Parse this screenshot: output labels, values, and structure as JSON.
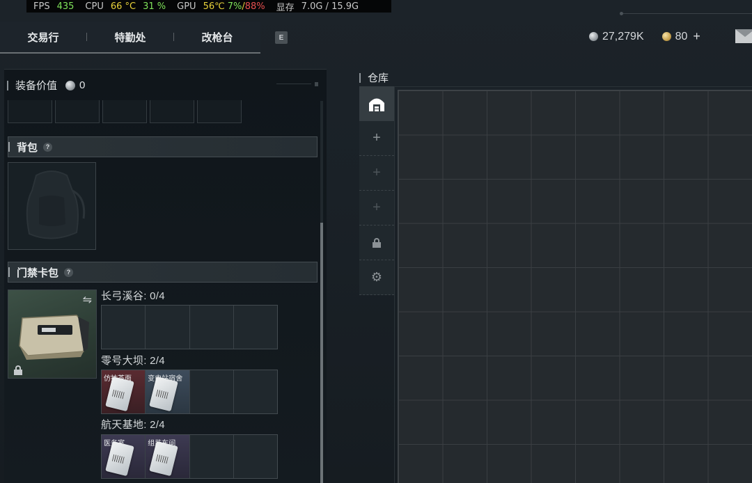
{
  "perf": {
    "fps_label": "FPS",
    "fps": "435",
    "cpu_label": "CPU",
    "cpu_temp": "66 °C",
    "cpu_usage": "31 %",
    "gpu_label": "GPU",
    "gpu_temp": "56℃",
    "gpu_usage": "7%",
    "gpu_sep": "/",
    "gpu_mem": "88%",
    "vram_label": "显存",
    "vram": "7.0G / 15.9G"
  },
  "nav": {
    "tabs": [
      {
        "label": "交易行"
      },
      {
        "label": "特勤处"
      },
      {
        "label": "改枪台"
      }
    ],
    "key_hint": "E"
  },
  "currency": {
    "silver": "27,279K",
    "gold": "80",
    "plus": "+"
  },
  "loadout": {
    "title": "装备价值",
    "value": "0",
    "backpack": {
      "label": "背包",
      "help": "?"
    },
    "keycard": {
      "label": "门禁卡包",
      "help": "?"
    },
    "maps": [
      {
        "title": "长弓溪谷: 0/4",
        "cards": []
      },
      {
        "title": "零号大坝: 2/4",
        "cards": [
          {
            "name": "仿抹茶面",
            "color": "red"
          },
          {
            "name": "变电站宿舍",
            "color": "blue"
          }
        ]
      },
      {
        "title": "航天基地: 2/4",
        "cards": [
          {
            "name": "医务室",
            "color": "purple"
          },
          {
            "name": "组装车间",
            "color": "purple"
          }
        ]
      }
    ]
  },
  "warehouse": {
    "title": "仓库",
    "tabs": [
      {
        "icon": "warehouse-icon",
        "state": "active"
      },
      {
        "icon": "plus-icon",
        "state": "normal"
      },
      {
        "icon": "plus-icon",
        "state": "dim"
      },
      {
        "icon": "plus-icon",
        "state": "dim"
      },
      {
        "icon": "lock-icon",
        "state": "normal"
      },
      {
        "icon": "gear-icon",
        "state": "normal"
      }
    ]
  },
  "colors": {
    "fps_green": "#7fe35a",
    "temp_yellow": "#e8d23a",
    "mem_red": "#e85050",
    "card_red": "#5a2b31",
    "card_blue": "#3e4c5c",
    "card_purple": "#3d3a52"
  }
}
